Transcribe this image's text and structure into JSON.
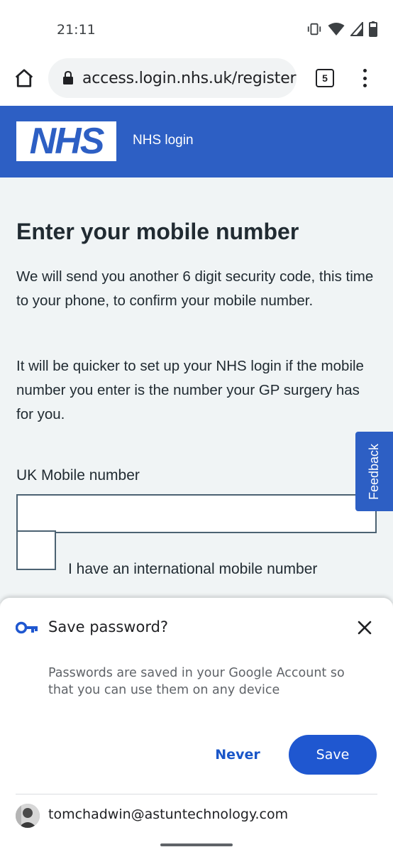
{
  "status_bar": {
    "time": "21:11",
    "icons": [
      "vibrate-icon",
      "wifi-icon",
      "signal-icon",
      "battery-icon"
    ]
  },
  "browser": {
    "url": "access.login.nhs.uk/register/",
    "tab_count": "5",
    "icons": [
      "home-icon",
      "lock-icon",
      "tabs-icon",
      "more-vert-icon"
    ]
  },
  "header": {
    "logo": "NHS",
    "service_name": "NHS login",
    "color": "#2d5fc4"
  },
  "main": {
    "title": "Enter your mobile number",
    "paragraph_1": "We will send you another 6 digit security code, this time to your phone, to confirm your mobile number.",
    "paragraph_2": "It will be quicker to set up your NHS login if the mobile number you enter is the number your GP surgery has for you.",
    "mobile_label": "UK Mobile number",
    "mobile_value": "",
    "international_label": "I have an international mobile number",
    "feedback_label": "Feedback"
  },
  "save_password": {
    "title": "Save password?",
    "description": "Passwords are saved in your Google Account so that you can use them on any device",
    "never_label": "Never",
    "save_label": "Save",
    "account_email": "tomchadwin@astuntechnology.com",
    "accent_color": "#1f57d0",
    "icons": [
      "key-icon",
      "close-icon",
      "avatar"
    ]
  }
}
